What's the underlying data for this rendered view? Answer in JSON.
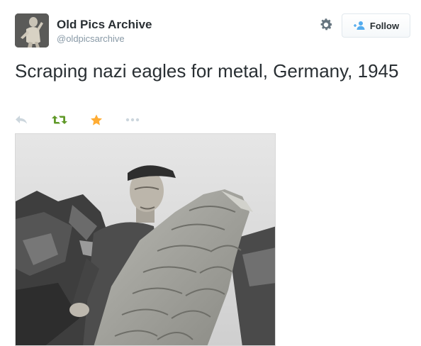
{
  "account": {
    "display_name": "Old Pics Archive",
    "handle": "@oldpicsarchive"
  },
  "follow_button": {
    "label": "Follow"
  },
  "tweet": {
    "text": "Scraping nazi eagles for metal, Germany, 1945"
  },
  "actions": {
    "icons": [
      "reply-icon",
      "retweet-icon",
      "favorite-icon",
      "more-icon"
    ]
  },
  "colors": {
    "reply": "#ccd6dd",
    "retweet": "#19cf86",
    "retweet_dark": "#609928",
    "favorite": "#ffac33",
    "follow_icon": "#55acee",
    "gear": "#66757f",
    "handle": "#8899a6"
  }
}
